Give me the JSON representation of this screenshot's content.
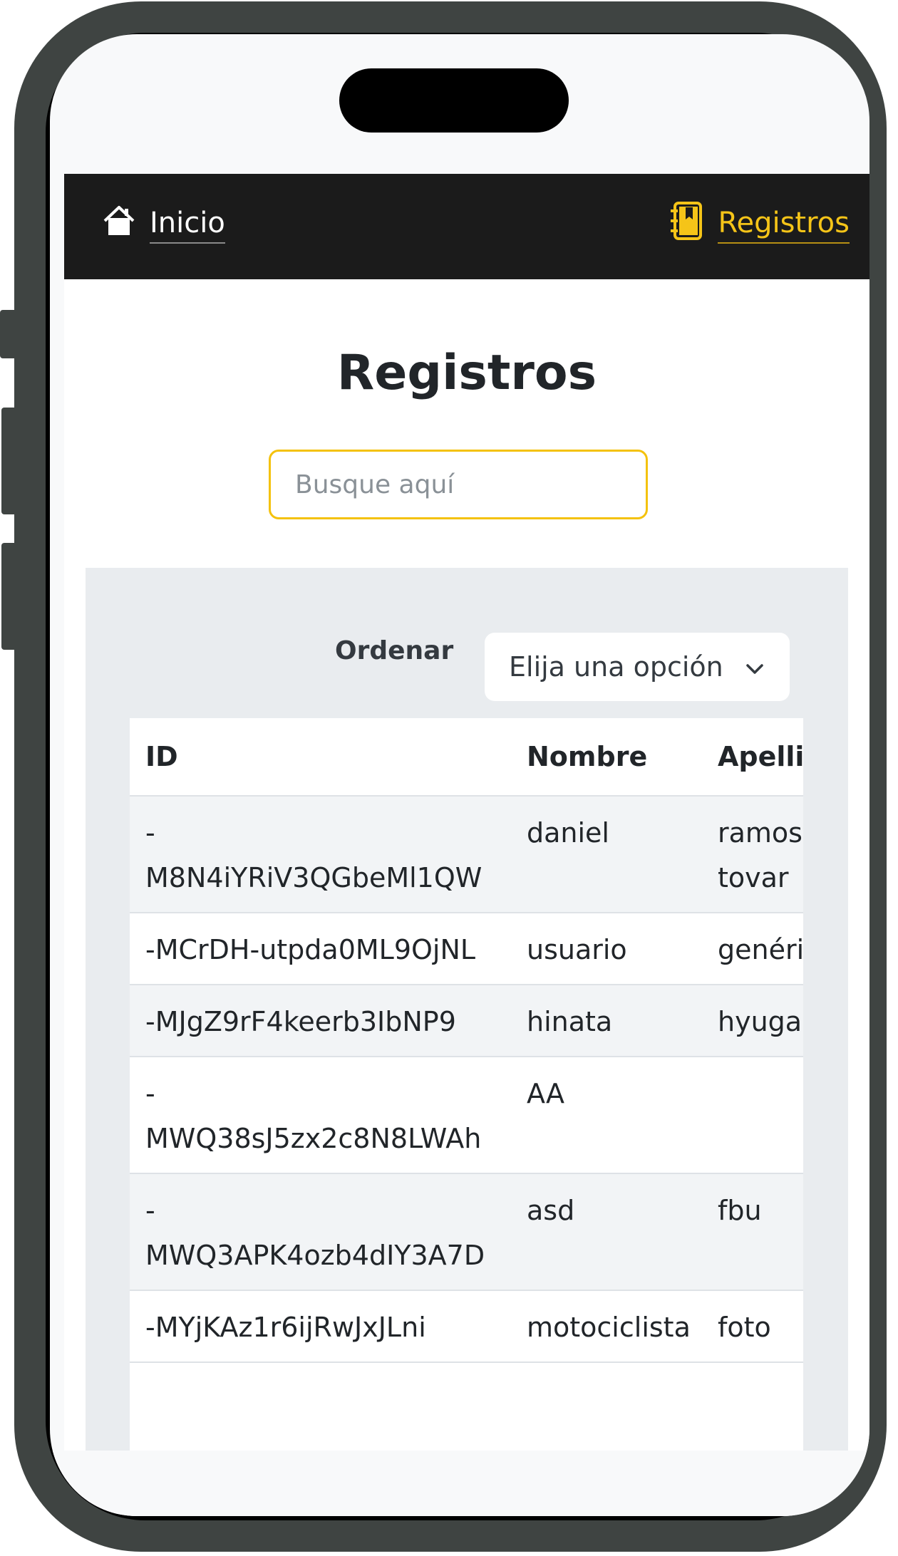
{
  "navbar": {
    "home_label": "Inicio",
    "home_icon": "house-icon",
    "records_label": "Registros",
    "records_icon": "address-book-icon",
    "colors": {
      "background": "#1b1b1b",
      "active": "#f5c418",
      "text": "#ffffff"
    }
  },
  "page": {
    "title": "Registros"
  },
  "search": {
    "placeholder": "Busque aquí",
    "value": ""
  },
  "sort": {
    "label": "Ordenar",
    "selected": "Elija una opción"
  },
  "table": {
    "columns": [
      "ID",
      "Nombre",
      "Apellido"
    ],
    "rows": [
      {
        "id": "-M8N4iYRiV3QGbeMl1QW",
        "nombre": "daniel",
        "apellido": "ramos tovar"
      },
      {
        "id": "-MCrDH-utpda0ML9OjNL",
        "nombre": "usuario",
        "apellido": "genérico"
      },
      {
        "id": "-MJgZ9rF4keerb3IbNP9",
        "nombre": "hinata",
        "apellido": "hyuga"
      },
      {
        "id": "-MWQ38sJ5zx2c8N8LWAh",
        "nombre": "AA",
        "apellido": ""
      },
      {
        "id": "-MWQ3APK4ozb4dIY3A7D",
        "nombre": "asd",
        "apellido": "fbu"
      },
      {
        "id": "-MYjKAz1r6ijRwJxJLni",
        "nombre": "motociclista",
        "apellido": "foto"
      }
    ]
  }
}
